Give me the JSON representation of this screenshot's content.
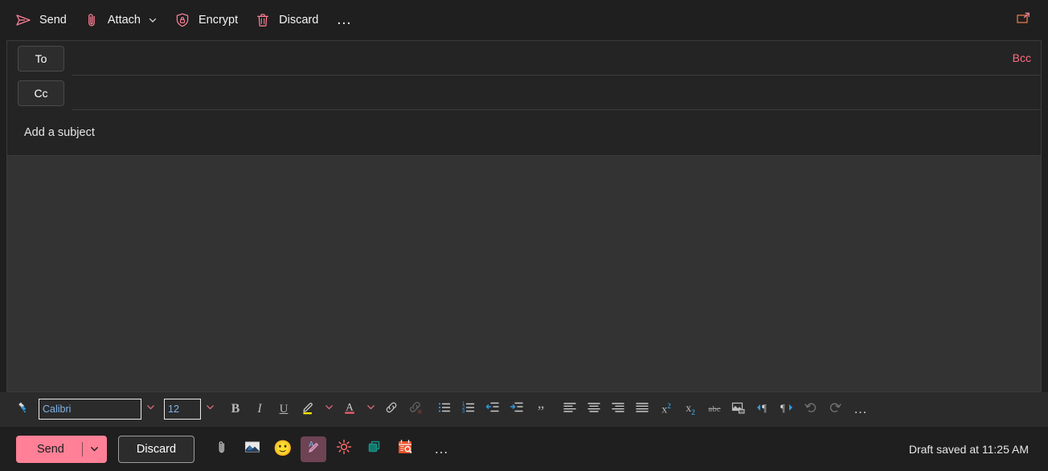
{
  "commandbar": {
    "items": [
      {
        "label": "Send",
        "icon": "send-icon"
      },
      {
        "label": "Attach",
        "icon": "paperclip-icon",
        "has_chevron": true
      },
      {
        "label": "Encrypt",
        "icon": "shield-lock-icon"
      },
      {
        "label": "Discard",
        "icon": "trash-icon"
      }
    ],
    "overflow_label": "…",
    "popout_icon": "pop-out-icon"
  },
  "compose": {
    "to": {
      "button_label": "To",
      "value": "",
      "placeholder": ""
    },
    "cc": {
      "button_label": "Cc",
      "value": "",
      "placeholder": ""
    },
    "bcc_link_label": "Bcc",
    "subject": {
      "value": "",
      "placeholder": "Add a subject"
    },
    "body": {
      "value": "",
      "placeholder": ""
    }
  },
  "format_toolbar": {
    "format_painter_icon": "format-painter-icon",
    "font_name": {
      "value": "Calibri",
      "chevron": "chevron-down-icon"
    },
    "font_size": {
      "value": "12",
      "chevron": "chevron-down-icon"
    },
    "buttons": [
      {
        "name": "bold-button",
        "label": "B"
      },
      {
        "name": "italic-button",
        "label": "I"
      },
      {
        "name": "underline-button",
        "label": "U"
      },
      {
        "name": "highlight-button",
        "label": ""
      },
      {
        "name": "font-color-button",
        "label": "A"
      },
      {
        "name": "insert-link-button",
        "label": ""
      },
      {
        "name": "remove-link-button",
        "label": ""
      },
      {
        "name": "bulleted-list-button",
        "label": ""
      },
      {
        "name": "numbered-list-button",
        "label": ""
      },
      {
        "name": "decrease-indent-button",
        "label": ""
      },
      {
        "name": "increase-indent-button",
        "label": ""
      },
      {
        "name": "quote-button",
        "label": "”"
      },
      {
        "name": "align-left-button",
        "label": ""
      },
      {
        "name": "align-center-button",
        "label": ""
      },
      {
        "name": "align-right-button",
        "label": ""
      },
      {
        "name": "justify-button",
        "label": ""
      },
      {
        "name": "superscript-button",
        "label": "x"
      },
      {
        "name": "subscript-button",
        "label": "x"
      },
      {
        "name": "strikethrough-button",
        "label": "abc"
      },
      {
        "name": "insert-picture-button",
        "label": ""
      },
      {
        "name": "ltr-direction-button",
        "label": ""
      },
      {
        "name": "rtl-direction-button",
        "label": ""
      },
      {
        "name": "undo-button",
        "label": ""
      },
      {
        "name": "redo-button",
        "label": ""
      }
    ],
    "overflow_label": "…"
  },
  "bottombar": {
    "send_label": "Send",
    "send_chevron": "chevron-down-icon",
    "discard_label": "Discard",
    "tools": [
      {
        "name": "attach-file-button",
        "icon": "paperclip-icon"
      },
      {
        "name": "insert-picture-button",
        "icon": "picture-icon"
      },
      {
        "name": "emoji-button",
        "icon": "smiley-icon",
        "glyph": "🙂"
      },
      {
        "name": "dictate-draft-button",
        "icon": "pen-a-icon",
        "selected": true
      },
      {
        "name": "ideas-button",
        "icon": "sun-icon"
      },
      {
        "name": "loop-components-button",
        "icon": "loop-square-icon"
      },
      {
        "name": "bookings-button",
        "icon": "calendar-search-icon"
      }
    ],
    "overflow_label": "…",
    "draft_status": "Draft saved at 11:25 AM"
  },
  "colors": {
    "accent_pink": "#ff8097",
    "link_pink": "#ff6b81",
    "body_bg": "#333333",
    "chrome_bg": "#1f1f1f",
    "toolbar_bg": "#2b2b2b"
  }
}
